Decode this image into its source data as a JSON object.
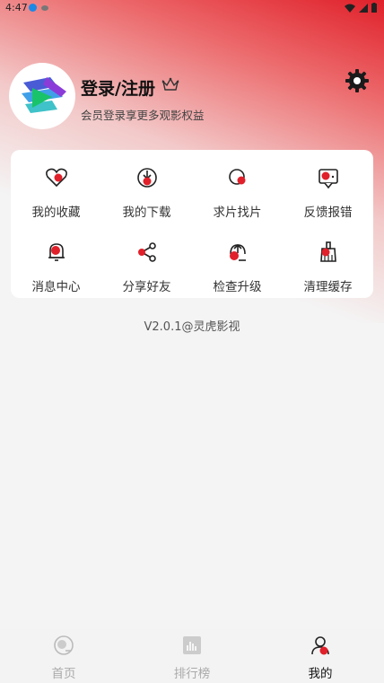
{
  "status_bar": {
    "time": "4:47"
  },
  "profile": {
    "login_label": "登录/注册",
    "subtitle": "会员登录享更多观影权益"
  },
  "menu": {
    "items": [
      {
        "label": "我的收藏",
        "icon": "heart-icon"
      },
      {
        "label": "我的下载",
        "icon": "download-icon"
      },
      {
        "label": "求片找片",
        "icon": "search-film-icon"
      },
      {
        "label": "反馈报错",
        "icon": "feedback-icon"
      },
      {
        "label": "消息中心",
        "icon": "bell-icon"
      },
      {
        "label": "分享好友",
        "icon": "share-icon"
      },
      {
        "label": "检查升级",
        "icon": "upgrade-icon"
      },
      {
        "label": "清理缓存",
        "icon": "broom-icon"
      }
    ]
  },
  "version": "V2.0.1@灵虎影视",
  "tabbar": {
    "tabs": [
      {
        "label": "首页",
        "active": false
      },
      {
        "label": "排行榜",
        "active": false
      },
      {
        "label": "我的",
        "active": true
      }
    ]
  },
  "colors": {
    "accent": "#e0202a",
    "text": "#333333",
    "inactive_tab": "#aaaaaa"
  }
}
